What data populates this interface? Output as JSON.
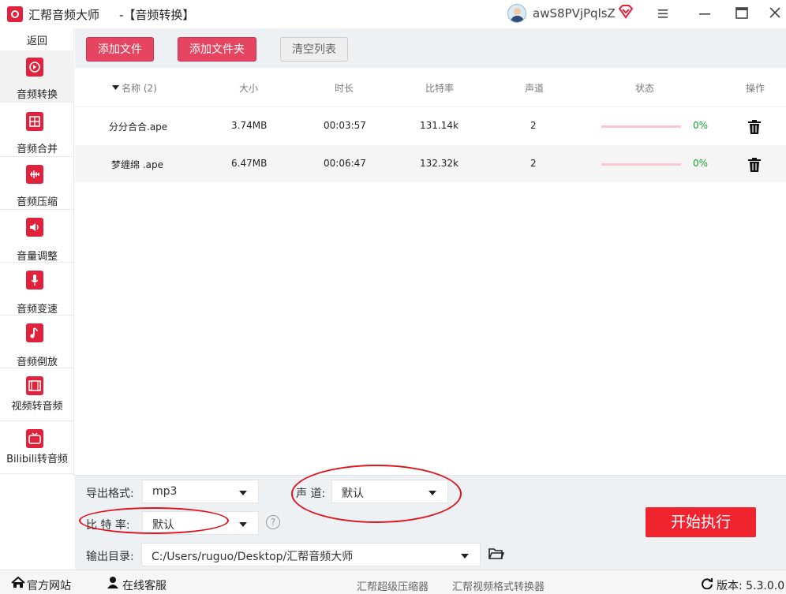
{
  "window": {
    "app_name": "汇帮音频大师",
    "section_title": "-【音频转换】",
    "username": "awS8PVjPqlsZ"
  },
  "sidebar": {
    "back_label": "返回",
    "items": [
      {
        "label": "音频转换",
        "icon": "audio-convert-icon",
        "active": true
      },
      {
        "label": "音频合并",
        "icon": "audio-merge-icon",
        "active": false
      },
      {
        "label": "音频压缩",
        "icon": "audio-compress-icon",
        "active": false
      },
      {
        "label": "音量调整",
        "icon": "volume-adjust-icon",
        "active": false
      },
      {
        "label": "音频变速",
        "icon": "microphone-icon",
        "active": false
      },
      {
        "label": "音频倒放",
        "icon": "music-note-icon",
        "active": false
      },
      {
        "label": "视频转音频",
        "icon": "film-icon",
        "active": false
      },
      {
        "label": "Bilibili转音频",
        "icon": "tv-icon",
        "active": false
      }
    ]
  },
  "toolbar": {
    "add_file_label": "添加文件",
    "add_folder_label": "添加文件夹",
    "clear_list_label": "清空列表"
  },
  "table": {
    "headers": {
      "name": "名称 (2)",
      "size": "大小",
      "duration": "时长",
      "bitrate": "比特率",
      "channels": "声道",
      "status": "状态",
      "actions": "操作"
    },
    "rows": [
      {
        "name": "分分合合.ape",
        "size": "3.74MB",
        "duration": "00:03:57",
        "bitrate": "131.14k",
        "channels": "2",
        "progress": "0%"
      },
      {
        "name": "梦缠绵 .ape",
        "size": "6.47MB",
        "duration": "00:06:47",
        "bitrate": "132.32k",
        "channels": "2",
        "progress": "0%"
      }
    ]
  },
  "settings": {
    "format_label": "导出格式:",
    "format_value": "mp3",
    "channel_label": "声 道:",
    "channel_value": "默认",
    "bitrate_label": "比 特 率:",
    "bitrate_value": "默认",
    "help_glyph": "?",
    "output_label": "输出目录:",
    "output_value": "C:/Users/ruguo/Desktop/汇帮音频大师",
    "start_label": "开始执行"
  },
  "footer": {
    "official_site": "官方网站",
    "online_service": "在线客服",
    "link_compressor": "汇帮超级压缩器",
    "link_video_converter": "汇帮视频格式转换器",
    "version": "版本: 5.3.0.0"
  },
  "colors": {
    "brand_red": "#e0223c",
    "button_red": "#e54560",
    "start_red": "#f0232f",
    "progress_green": "#18a030",
    "annotation_red": "#e0101a"
  }
}
